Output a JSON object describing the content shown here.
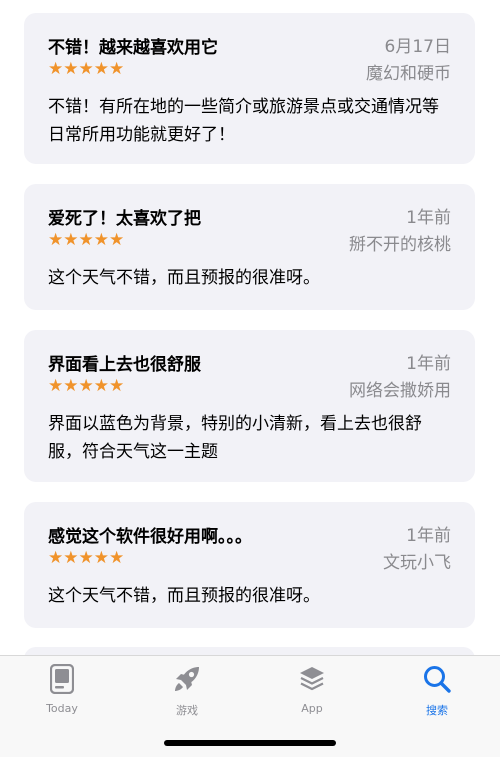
{
  "reviews": [
    {
      "title": "不错！越来越喜欢用它",
      "date": "6月17日",
      "stars": "★★★★★",
      "author": "魔幻和硬币",
      "body": " 不错！有所在地的一些简介或旅游景点或交通情况等日常所用功能就更好了！"
    },
    {
      "title": "爱死了！太喜欢了把",
      "date": "1年前",
      "stars": "★★★★★",
      "author": "掰不开的核桃",
      "body": "这个天气不错，而且预报的很准呀。"
    },
    {
      "title": "界面看上去也很舒服",
      "date": "1年前",
      "stars": "★★★★★",
      "author": "网络会撒娇用",
      "body": " 界面以蓝色为背景，特别的小清新，看上去也很舒服，符合天气这一主题"
    },
    {
      "title": "感觉这个软件很好用啊。。。",
      "date": "1年前",
      "stars": "★★★★★",
      "author": "文玩小飞",
      "body": "这个天气不错，而且预报的很准呀。"
    }
  ],
  "tabs": [
    {
      "label": "Today",
      "icon": "today-icon"
    },
    {
      "label": "游戏",
      "icon": "rocket-icon"
    },
    {
      "label": "App",
      "icon": "app-stack-icon"
    },
    {
      "label": "搜索",
      "icon": "search-icon"
    }
  ],
  "colors": {
    "star": "#f0932b",
    "card": "#f2f2f7",
    "accent": "#1a74e8",
    "muted": "#8a8a8e"
  }
}
